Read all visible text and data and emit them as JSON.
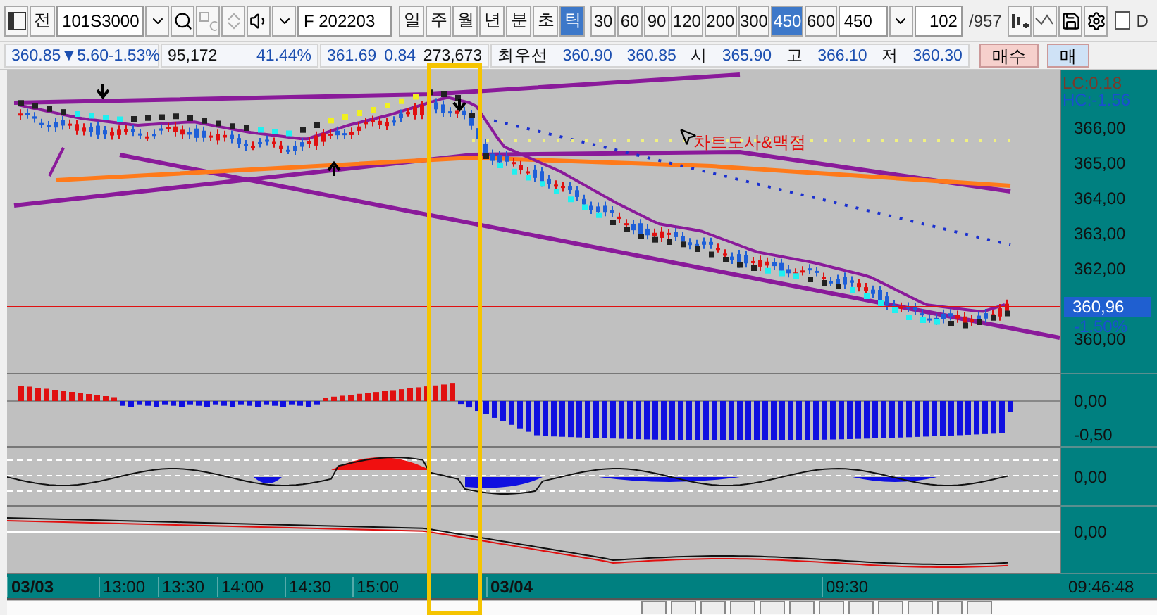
{
  "toolbar": {
    "prev_label": "전",
    "code": "101S3000",
    "contract": "F 202203",
    "periods": [
      {
        "label": "일",
        "selected": false
      },
      {
        "label": "주",
        "selected": false
      },
      {
        "label": "월",
        "selected": false
      },
      {
        "label": "년",
        "selected": false
      },
      {
        "label": "분",
        "selected": false
      },
      {
        "label": "초",
        "selected": false
      },
      {
        "label": "틱",
        "selected": true
      }
    ],
    "intervals": [
      {
        "label": "30",
        "selected": false
      },
      {
        "label": "60",
        "selected": false
      },
      {
        "label": "90",
        "selected": false
      },
      {
        "label": "120",
        "selected": false
      },
      {
        "label": "200",
        "selected": false
      },
      {
        "label": "300",
        "selected": false
      },
      {
        "label": "450",
        "selected": true
      },
      {
        "label": "600",
        "selected": false
      }
    ],
    "interval_value": "450",
    "count": "102",
    "total": "/957",
    "d_checkbox": {
      "label": "D",
      "checked": false
    }
  },
  "quote": {
    "price": "360.85",
    "direction": "▼",
    "change": "5.60",
    "change_rate": "-1.53%",
    "volume": "95,172",
    "volume_rate": "41.44%",
    "price_2": "361.69",
    "change_2": "0.84",
    "volume_2": "273,673",
    "best_label": "최우선",
    "best_ask": "360.90",
    "best_bid": "360.85",
    "open_label": "시",
    "open": "365.90",
    "high_label": "고",
    "high": "366.10",
    "low_label": "저",
    "low": "360.30",
    "buy_button": "매수",
    "sell_button": "매"
  },
  "chart": {
    "annotation": "차트도사&맥점",
    "lc_label": "LC:0.18",
    "hc_label": "HC:-1.56",
    "price_ticks": [
      "366,00",
      "365,00",
      "364,00",
      "363,00",
      "362,00",
      "360,00"
    ],
    "current_price": "360,96",
    "current_change": "-1.50%",
    "panels": [
      {
        "ticks": [
          "0,00",
          "-0,50"
        ]
      },
      {
        "ticks": [
          "0,00"
        ]
      },
      {
        "ticks": [
          "0,00"
        ]
      }
    ],
    "time_labels": [
      {
        "label": "03/03",
        "kind": "date"
      },
      {
        "label": "13:00",
        "kind": "time"
      },
      {
        "label": "13:30",
        "kind": "time"
      },
      {
        "label": "14:00",
        "kind": "time"
      },
      {
        "label": "14:30",
        "kind": "time"
      },
      {
        "label": "15:00",
        "kind": "time"
      },
      {
        "label": "03/04",
        "kind": "date"
      },
      {
        "label": "09:30",
        "kind": "time"
      }
    ],
    "clock": "09:46:48"
  }
}
